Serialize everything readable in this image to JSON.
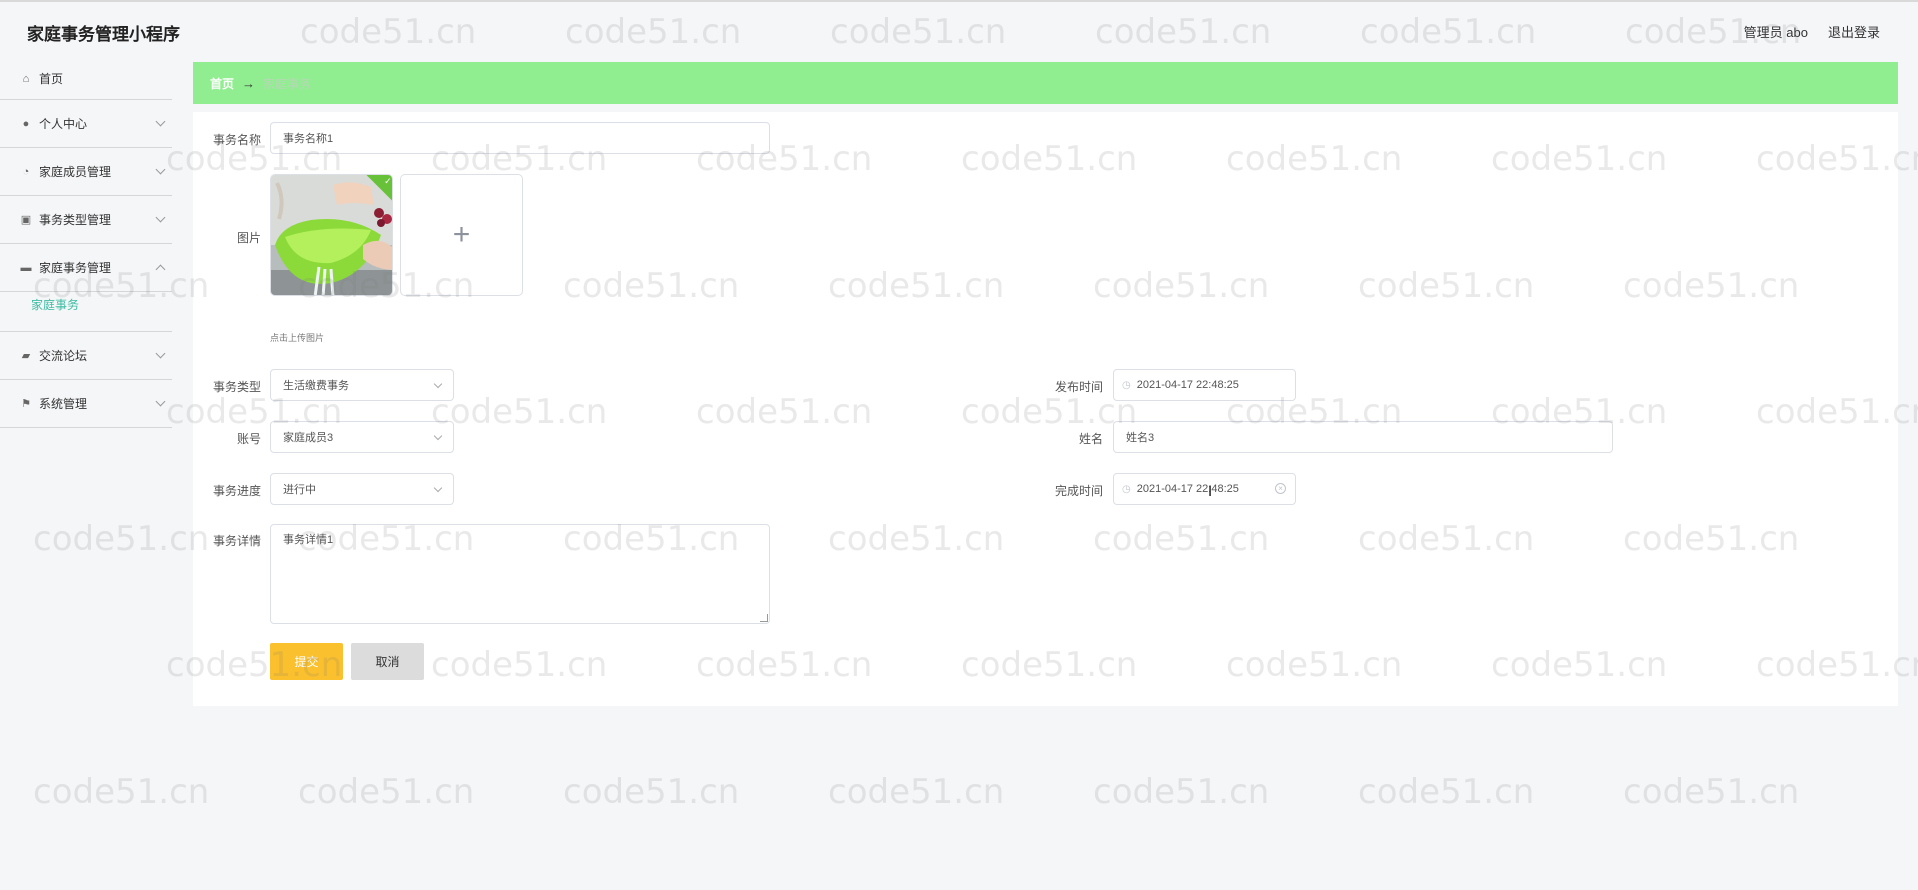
{
  "app": {
    "title": "家庭事务管理小程序",
    "user_label": "管理员 abo",
    "logout_label": "退出登录"
  },
  "sidebar": {
    "items": [
      {
        "label": "首页",
        "icon": "home-icon",
        "glyph": "⌂"
      },
      {
        "label": "个人中心",
        "icon": "user-icon",
        "glyph": "●"
      },
      {
        "label": "家庭成员管理",
        "icon": "dashboard-icon",
        "glyph": "◔"
      },
      {
        "label": "事务类型管理",
        "icon": "clipboard-icon",
        "glyph": "▣"
      },
      {
        "label": "家庭事务管理",
        "icon": "briefcase-icon",
        "glyph": "▬"
      },
      {
        "label": "交流论坛",
        "icon": "ticket-icon",
        "glyph": "▰"
      },
      {
        "label": "系统管理",
        "icon": "flag-icon",
        "glyph": "⚑"
      }
    ],
    "submenu_active": "家庭事务"
  },
  "breadcrumb": {
    "home": "首页",
    "separator": "→",
    "current": "家庭事务"
  },
  "form": {
    "name_label": "事务名称",
    "name_value": "事务名称1",
    "image_label": "图片",
    "upload_plus": "+",
    "upload_tip": "点击上传图片",
    "type_label": "事务类型",
    "type_value": "生活缴费事务",
    "account_label": "账号",
    "account_value": "家庭成员3",
    "progress_label": "事务进度",
    "progress_value": "进行中",
    "detail_label": "事务详情",
    "detail_value": "事务详情1",
    "publish_time_label": "发布时间",
    "publish_time_value": "2021-04-17 22:48:25",
    "person_name_label": "姓名",
    "person_name_value": "姓名3",
    "finish_time_label": "完成时间",
    "finish_time_value": "2021-04-17 22:48:25",
    "submit_label": "提交",
    "cancel_label": "取消"
  },
  "watermark": "code51.cn",
  "colors": {
    "breadcrumb_bg": "#90ee90",
    "submit_bg": "#fbc02d",
    "active_submenu": "#3dbda3",
    "success_check": "#67c23a"
  }
}
